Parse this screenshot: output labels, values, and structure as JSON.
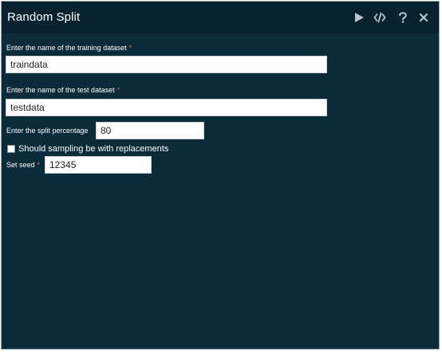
{
  "window": {
    "title": "Random Split"
  },
  "toolbar": {
    "run_icon": "play-icon",
    "code_icon": "code-icon",
    "help_icon": "help-icon",
    "close_icon": "close-icon",
    "icon_color": "#b9c4cb"
  },
  "form": {
    "training": {
      "label": "Enter the name of the training dataset",
      "required_marker": "*",
      "value": "traindata"
    },
    "test": {
      "label": "Enter the name of the test dataset",
      "required_marker": "*",
      "value": "testdata"
    },
    "split": {
      "label": "Enter the split percentage",
      "value": "80"
    },
    "replacement": {
      "label": "Should sampling be with replacements",
      "checked": false
    },
    "seed": {
      "label": "Set seed",
      "required_marker": "*",
      "value": "12345"
    }
  },
  "colors": {
    "panel_background": "#0c2b3a",
    "header_background": "#08222f",
    "required_marker": "#e8665a"
  }
}
